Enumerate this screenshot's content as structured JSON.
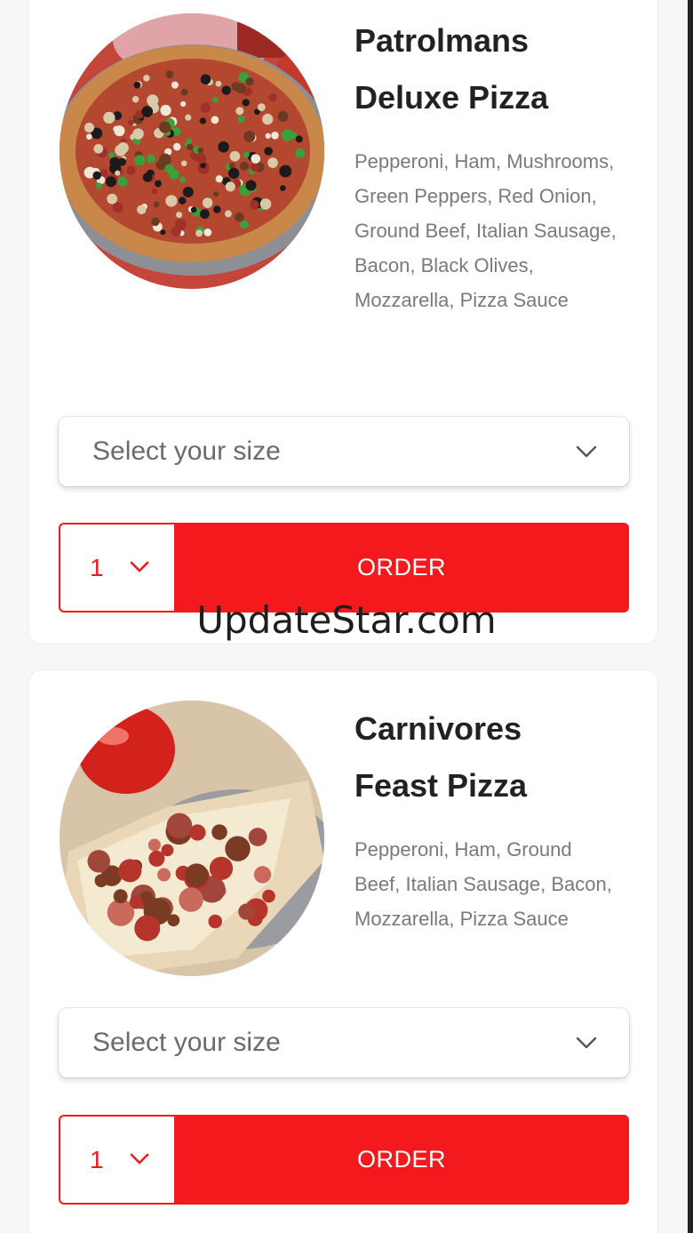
{
  "items": [
    {
      "title": "Patrolmans\nDeluxe Pizza",
      "description": "Pepperoni, Ham, Mushrooms, Green Peppers, Red Onion, Ground Beef, Italian Sausage, Bacon, Black Olives, Mozzarella, Pizza Sauce",
      "size_placeholder": "Select your size",
      "quantity": "1",
      "order_label": "ORDER",
      "image": "pizza-deluxe-photo"
    },
    {
      "title": "Carnivores\nFeast Pizza",
      "description": "Pepperoni, Ham, Ground Beef, Italian Sausage, Bacon, Mozzarella, Pizza Sauce",
      "size_placeholder": "Select your size",
      "quantity": "1",
      "order_label": "ORDER",
      "image": "pizza-meat-photo"
    }
  ],
  "watermark": "UpdateStar.com",
  "colors": {
    "accent": "#f4191c",
    "title": "#222222",
    "description": "#7a7a7a"
  },
  "icons": {
    "size_chevron": "chevron-down-icon",
    "qty_chevron": "chevron-down-icon"
  }
}
